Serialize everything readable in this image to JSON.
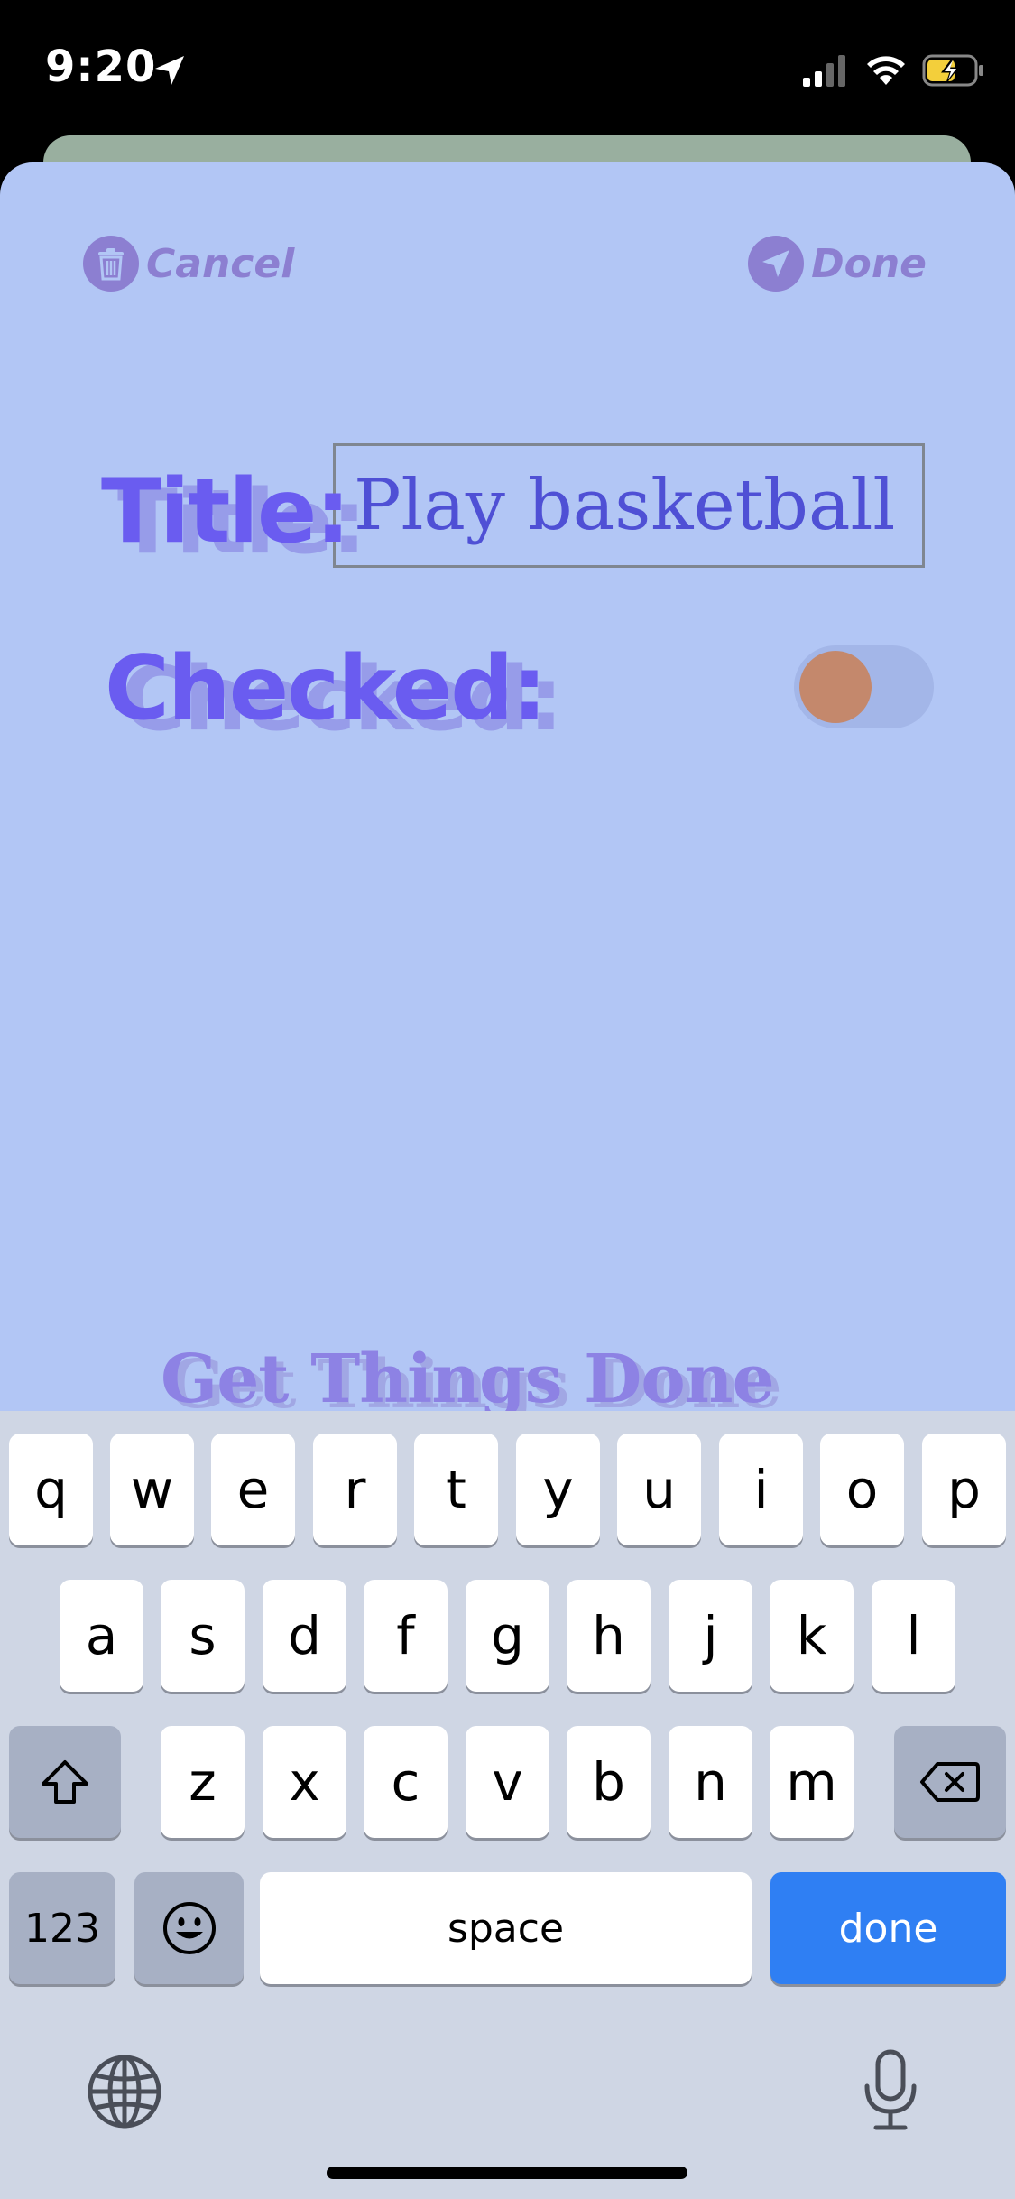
{
  "status_bar": {
    "time": "9:20",
    "icons": [
      "location-arrow-icon",
      "cellular-signal-icon",
      "wifi-icon",
      "battery-charging-icon"
    ]
  },
  "nav": {
    "cancel_label": "Cancel",
    "done_label": "Done",
    "cancel_icon": "trash-icon",
    "done_icon": "send-icon"
  },
  "form": {
    "title_label": "Title:",
    "title_value": "Play basketball",
    "checked_label": "Checked:",
    "checked_on": false
  },
  "footer": {
    "app_title": "Get Things Done"
  },
  "keyboard": {
    "row1": [
      "q",
      "w",
      "e",
      "r",
      "t",
      "y",
      "u",
      "i",
      "o",
      "p"
    ],
    "row2": [
      "a",
      "s",
      "d",
      "f",
      "g",
      "h",
      "j",
      "k",
      "l"
    ],
    "row3": [
      "z",
      "x",
      "c",
      "v",
      "b",
      "n",
      "m"
    ],
    "numbers_key": "123",
    "space_key": "space",
    "return_key": "done",
    "icons": [
      "shift-icon",
      "backspace-icon",
      "emoji-icon",
      "globe-icon",
      "microphone-icon"
    ]
  },
  "colors": {
    "sheet_bg": "#b2c6f5",
    "accent": "#6a5cf0",
    "toggle_knob": "#c4886c",
    "return_key": "#2f7ff3"
  }
}
